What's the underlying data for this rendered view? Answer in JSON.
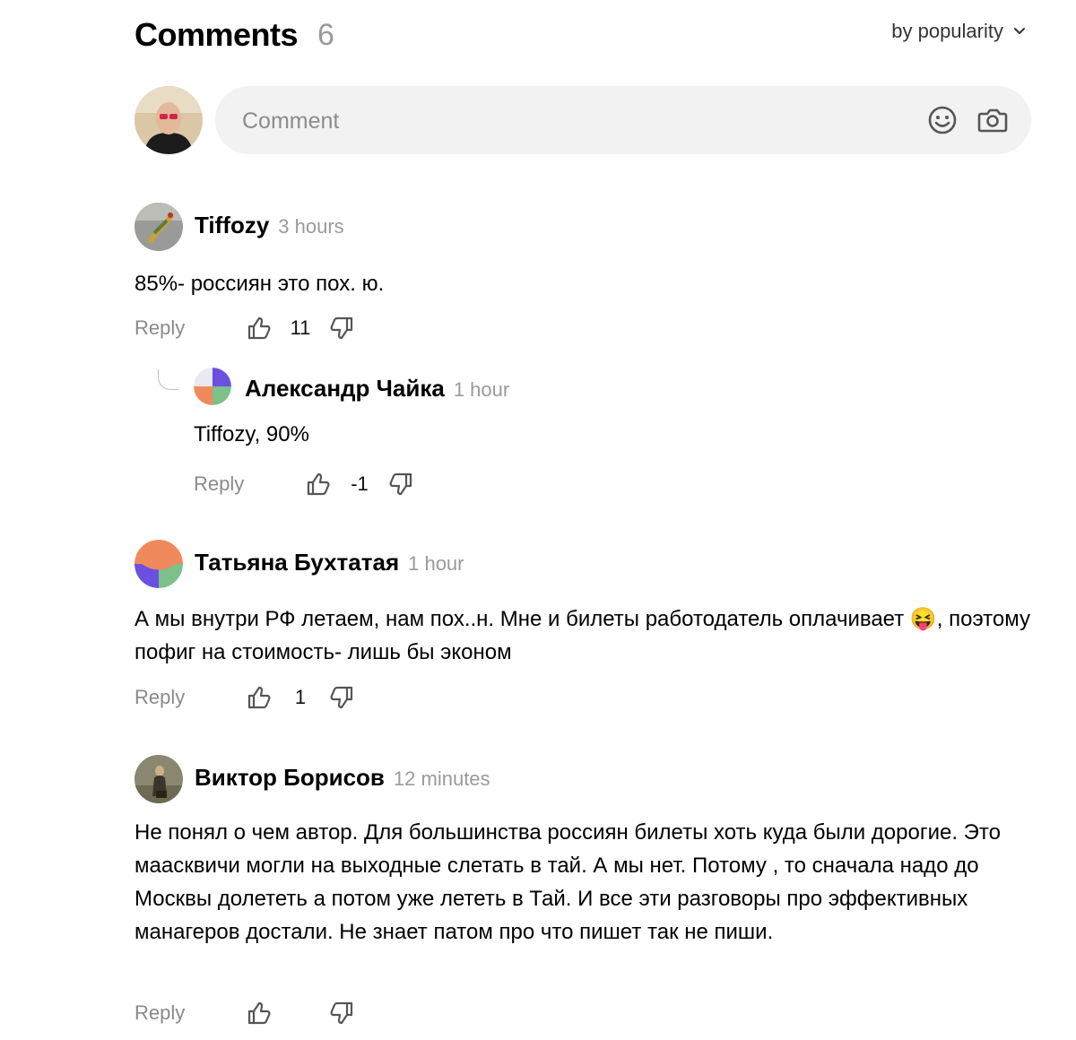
{
  "header": {
    "title": "Comments",
    "count": "6",
    "sort_label": "by popularity"
  },
  "composer": {
    "placeholder": "Comment"
  },
  "comments": [
    {
      "author": "Tiffozy",
      "time": "3 hours",
      "text": "85%- россиян это пох. ю.",
      "reply_label": "Reply",
      "score": "11",
      "indent": false
    },
    {
      "author": "Александр Чайка",
      "time": "1 hour",
      "text": "Tiffozy, 90%",
      "reply_label": "Reply",
      "score": "-1",
      "indent": true
    },
    {
      "author": "Татьяна Бухтатая",
      "time": "1 hour",
      "text": "А мы внутри РФ летаем, нам пох..н. Мне и билеты работодатель оплачивает 😝, поэтому пофиг на стоимость- лишь бы эконом",
      "reply_label": "Reply",
      "score": "1",
      "indent": false
    },
    {
      "author": "Виктор Борисов",
      "time": "12 minutes",
      "text": "Не понял о чем автор. Для большинства россиян билеты хоть куда были дорогие. Это мааскви­чи могли на выходные слетать в тай. А мы нет. Потому , то сначала надо до Москвы долететь а потом уже лететь в Тай. И все эти разговоры про эффективных манагеров достали. Не знает патом про что пишет так не пиши.",
      "reply_label": "Reply",
      "score": "",
      "indent": false
    }
  ],
  "colors": {
    "muted": "#9a9a9a",
    "pill": "#f2f2f2",
    "orange": "#f08a5d",
    "purple": "#6a4fe0",
    "green": "#7cc08a"
  }
}
